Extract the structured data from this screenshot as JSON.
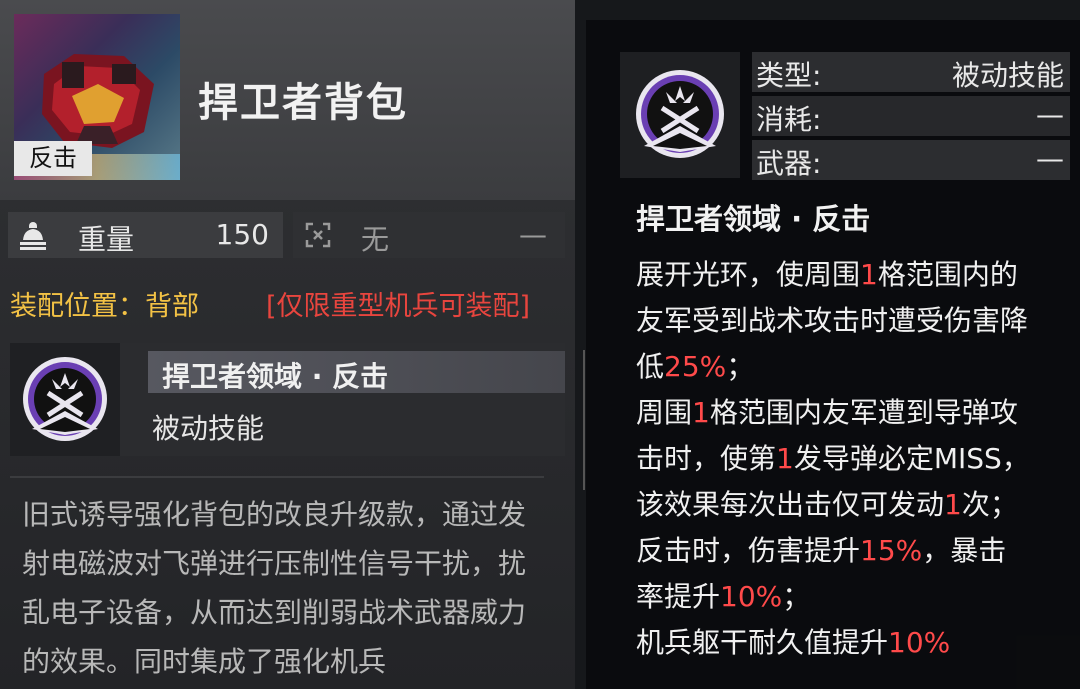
{
  "item": {
    "title": "捍卫者背包",
    "tag": "反击",
    "weight_label": "重量",
    "weight_value": "150",
    "energy_value": "无",
    "energy_dash": "—",
    "equip_slot": "装配位置：背部",
    "restriction": "[仅限重型机兵可装配]",
    "skill_name": "捍卫者领域 · 反击",
    "skill_type": "被动技能",
    "description": "旧式诱导强化背包的改良升级款，通过发射电磁波对飞弹进行压制性信号干扰，扰乱电子设备，从而达到削弱战术武器威力的效果。同时集成了强化机兵"
  },
  "skill_panel": {
    "type_label": "类型:",
    "type_value": "被动技能",
    "cost_label": "消耗:",
    "cost_value": "—",
    "weapon_label": "武器:",
    "weapon_value": "—",
    "title": "捍卫者领域 · 反击",
    "desc_lines": [
      [
        {
          "t": "展开光环，使周围"
        },
        {
          "t": "1",
          "hl": true
        },
        {
          "t": "格范围内的"
        }
      ],
      [
        {
          "t": "友军受到战术攻击时遭受伤害降"
        }
      ],
      [
        {
          "t": "低"
        },
        {
          "t": "25%",
          "hl": true
        },
        {
          "t": "；"
        }
      ],
      [
        {
          "t": "周围"
        },
        {
          "t": "1",
          "hl": true
        },
        {
          "t": "格范围内友军遭到导弹攻"
        }
      ],
      [
        {
          "t": "击时，使第"
        },
        {
          "t": "1",
          "hl": true
        },
        {
          "t": "发导弹必定MISS，"
        }
      ],
      [
        {
          "t": "该效果每次出击仅可发动"
        },
        {
          "t": "1",
          "hl": true
        },
        {
          "t": "次；"
        }
      ],
      [
        {
          "t": "反击时，伤害提升"
        },
        {
          "t": "15%",
          "hl": true
        },
        {
          "t": "，暴击"
        }
      ],
      [
        {
          "t": "率提升"
        },
        {
          "t": "10%",
          "hl": true
        },
        {
          "t": "；"
        }
      ],
      [
        {
          "t": "机兵躯干耐久值提升"
        },
        {
          "t": "10%",
          "hl": true
        }
      ]
    ]
  },
  "colors": {
    "highlight": "#ff4a4a",
    "equip_slot": "#f3c245",
    "restriction": "#e8453e",
    "skill_icon_ring": "#6a3fb3"
  },
  "icons": [
    "weight-bell-icon",
    "expand-icon",
    "skill-shield-icon"
  ]
}
